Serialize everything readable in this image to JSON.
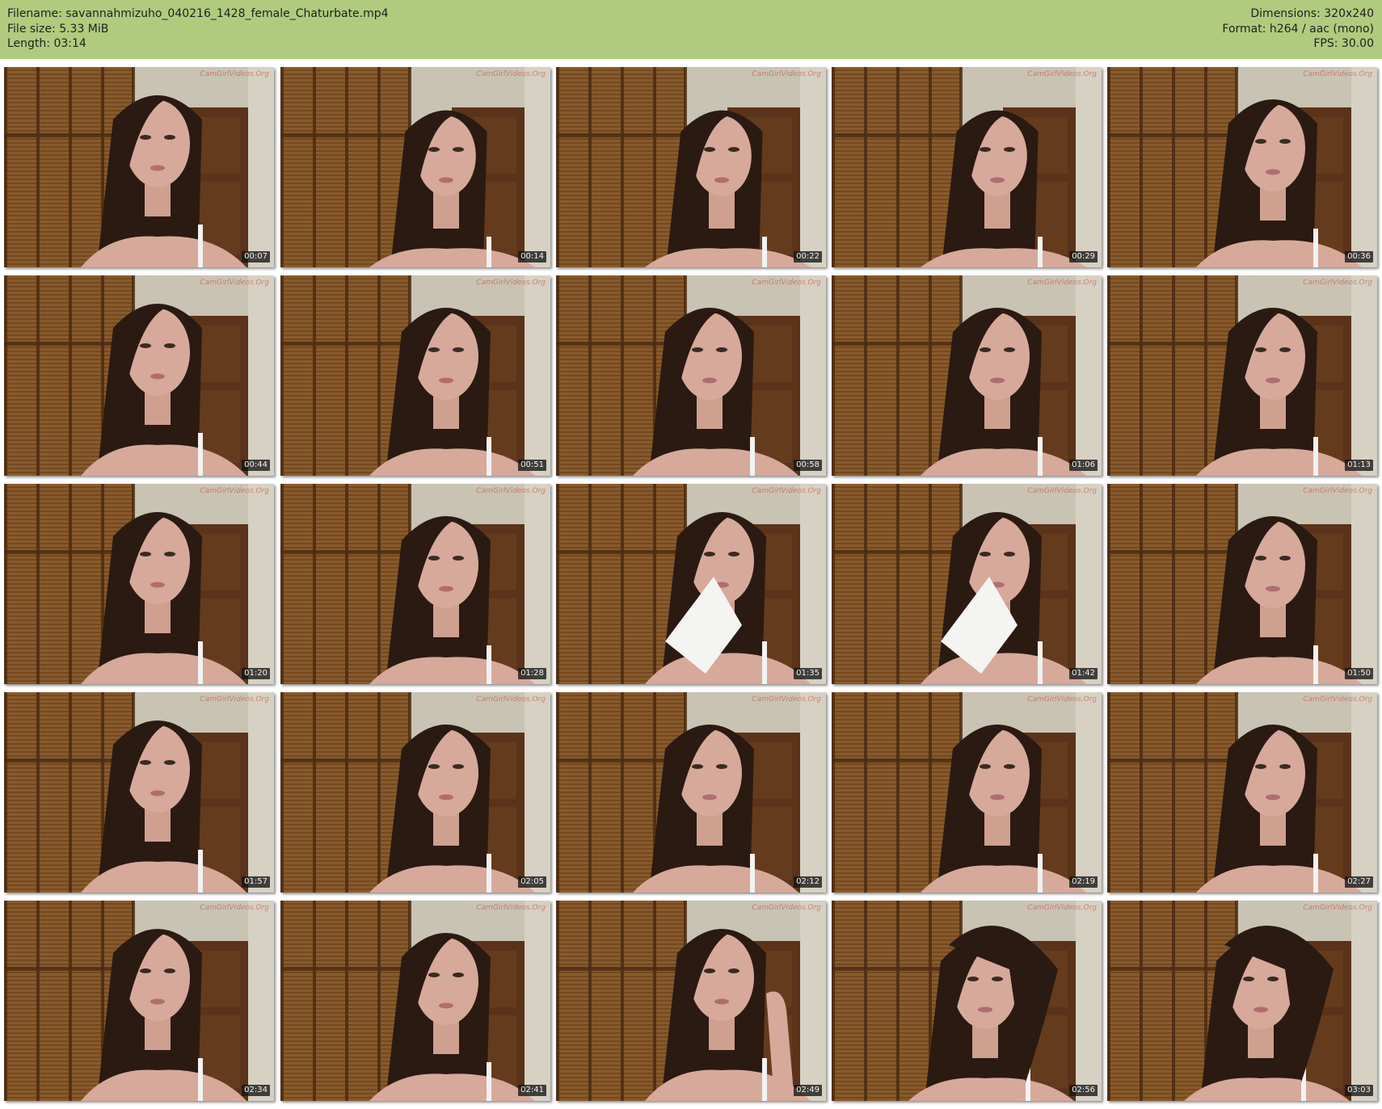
{
  "header": {
    "filename": "Filename: savannahmizuho_040216_1428_female_Chaturbate.mp4",
    "file_size": "File size: 5.33 MiB",
    "length": "Length: 03:14",
    "dimensions": "Dimensions: 320x240",
    "format": "Format: h264 / aac (mono)",
    "fps": "FPS: 30.00"
  },
  "colors": {
    "header_bg": "#b0cb7e",
    "shutter": "#8a5a2c",
    "wall": "#c9c3b4",
    "door": "#5a331a",
    "hair": "#2a1a12",
    "skin": "#d7a99a",
    "watermark": "#c84848"
  },
  "watermark": "CamGirlVideos.Org",
  "thumbnails": [
    {
      "time": "00:07",
      "pose": "left"
    },
    {
      "time": "00:14",
      "pose": "right-low"
    },
    {
      "time": "00:22",
      "pose": "right-low"
    },
    {
      "time": "00:29",
      "pose": "right-low"
    },
    {
      "time": "00:36",
      "pose": "right"
    },
    {
      "time": "00:44",
      "pose": "left"
    },
    {
      "time": "00:51",
      "pose": "right"
    },
    {
      "time": "00:58",
      "pose": "center"
    },
    {
      "time": "01:06",
      "pose": "right"
    },
    {
      "time": "01:13",
      "pose": "right"
    },
    {
      "time": "01:20",
      "pose": "left"
    },
    {
      "time": "01:28",
      "pose": "right"
    },
    {
      "time": "01:35",
      "pose": "tissue"
    },
    {
      "time": "01:42",
      "pose": "tissue"
    },
    {
      "time": "01:50",
      "pose": "right"
    },
    {
      "time": "01:57",
      "pose": "left"
    },
    {
      "time": "02:05",
      "pose": "right"
    },
    {
      "time": "02:12",
      "pose": "center"
    },
    {
      "time": "02:19",
      "pose": "right"
    },
    {
      "time": "02:27",
      "pose": "right"
    },
    {
      "time": "02:34",
      "pose": "left"
    },
    {
      "time": "02:41",
      "pose": "right"
    },
    {
      "time": "02:49",
      "pose": "hand"
    },
    {
      "time": "02:56",
      "pose": "hair"
    },
    {
      "time": "03:03",
      "pose": "hair"
    }
  ]
}
